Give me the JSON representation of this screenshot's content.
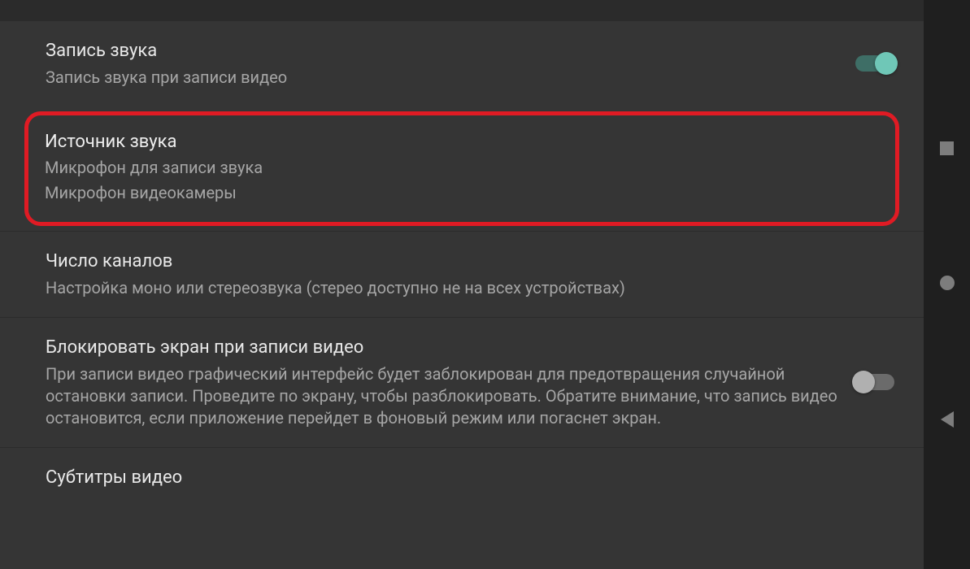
{
  "settings": {
    "audio_record": {
      "title": "Запись звука",
      "subtitle": "Запись звука при записи видео",
      "enabled": true
    },
    "audio_source": {
      "title": "Источник звука",
      "subtitle1": "Микрофон для записи звука",
      "subtitle2": "Микрофон видеокамеры"
    },
    "channels": {
      "title": "Число каналов",
      "subtitle": "Настройка моно или стереозвука (стерео доступно не на всех устройствах)"
    },
    "lock_screen": {
      "title": "Блокировать экран при записи видео",
      "subtitle": "При записи видео графический интерфейс будет заблокирован для предотвращения случайной остановки записи. Проведите по экрану, чтобы разблокировать. Обратите внимание, что запись видео остановится, если приложение перейдет в фоновый режим или погаснет экран.",
      "enabled": false
    },
    "subtitles": {
      "title": "Субтитры видео"
    }
  },
  "colors": {
    "accent": "#6fc7b7",
    "highlight_border": "#e01b24",
    "background": "#353535"
  }
}
